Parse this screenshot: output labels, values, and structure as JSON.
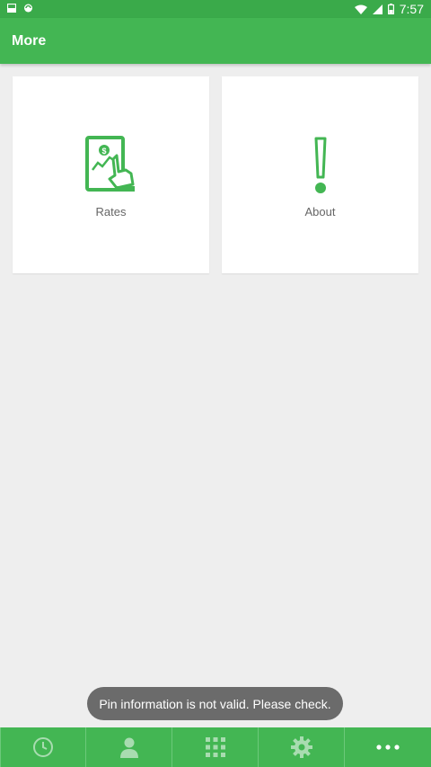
{
  "status_bar": {
    "time": "7:57",
    "icons": [
      "sim-card-icon",
      "sync-icon",
      "wifi-icon",
      "signal-icon",
      "battery-icon"
    ]
  },
  "app_bar": {
    "title": "More"
  },
  "cards": [
    {
      "label": "Rates",
      "icon": "rates-icon"
    },
    {
      "label": "About",
      "icon": "exclamation-icon"
    }
  ],
  "toast": {
    "message": "Pin information is not valid. Please check."
  },
  "bottom_nav": {
    "items": [
      "history-icon",
      "person-icon",
      "dialpad-icon",
      "settings-icon",
      "more-icon"
    ]
  },
  "colors": {
    "primary": "#43b653",
    "primary_dark": "#3aaa4a",
    "background": "#eeeeee",
    "toast": "#6b6b6b"
  }
}
